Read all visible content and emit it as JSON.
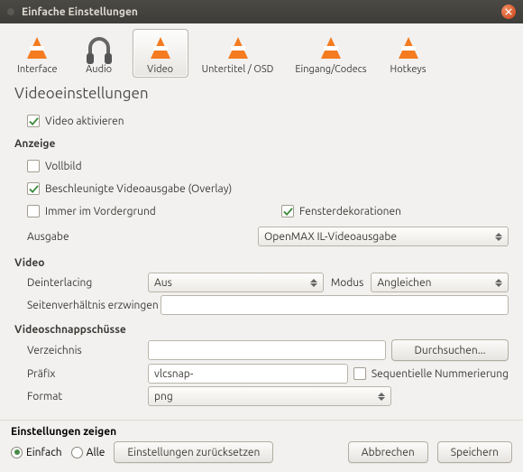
{
  "window": {
    "title": "Einfache Einstellungen"
  },
  "toolbar": {
    "interface": "Interface",
    "audio": "Audio",
    "video": "Video",
    "subtitle": "Untertitel / OSD",
    "input": "Eingang/Codecs",
    "hotkeys": "Hotkeys"
  },
  "page": {
    "heading": "Videoeinstellungen",
    "enable_video": "Video aktivieren",
    "display_section": "Anzeige",
    "fullscreen": "Vollbild",
    "overlay": "Beschleunigte Videoausgabe (Overlay)",
    "always_on_top": "Immer im Vordergrund",
    "window_deco": "Fensterdekorationen",
    "output_label": "Ausgabe",
    "output_value": "OpenMAX IL-Videoausgabe",
    "video_section": "Video",
    "deinterlacing_label": "Deinterlacing",
    "deinterlacing_value": "Aus",
    "mode_label": "Modus",
    "mode_value": "Angleichen",
    "aspect_label": "Seitenverhältnis erzwingen",
    "aspect_value": "",
    "snapshot_section": "Videoschnappschüsse",
    "directory_label": "Verzeichnis",
    "directory_value": "",
    "browse": "Durchsuchen...",
    "prefix_label": "Präfix",
    "prefix_value": "vlcsnap-",
    "sequential": "Sequentielle Nummerierung",
    "format_label": "Format",
    "format_value": "png"
  },
  "footer": {
    "show_settings": "Einstellungen zeigen",
    "simple": "Einfach",
    "all": "Alle",
    "reset": "Einstellungen zurücksetzen",
    "cancel": "Abbrechen",
    "save": "Speichern"
  },
  "checks": {
    "enable_video": true,
    "fullscreen": false,
    "overlay": true,
    "always_on_top": false,
    "window_deco": true,
    "sequential": false
  }
}
